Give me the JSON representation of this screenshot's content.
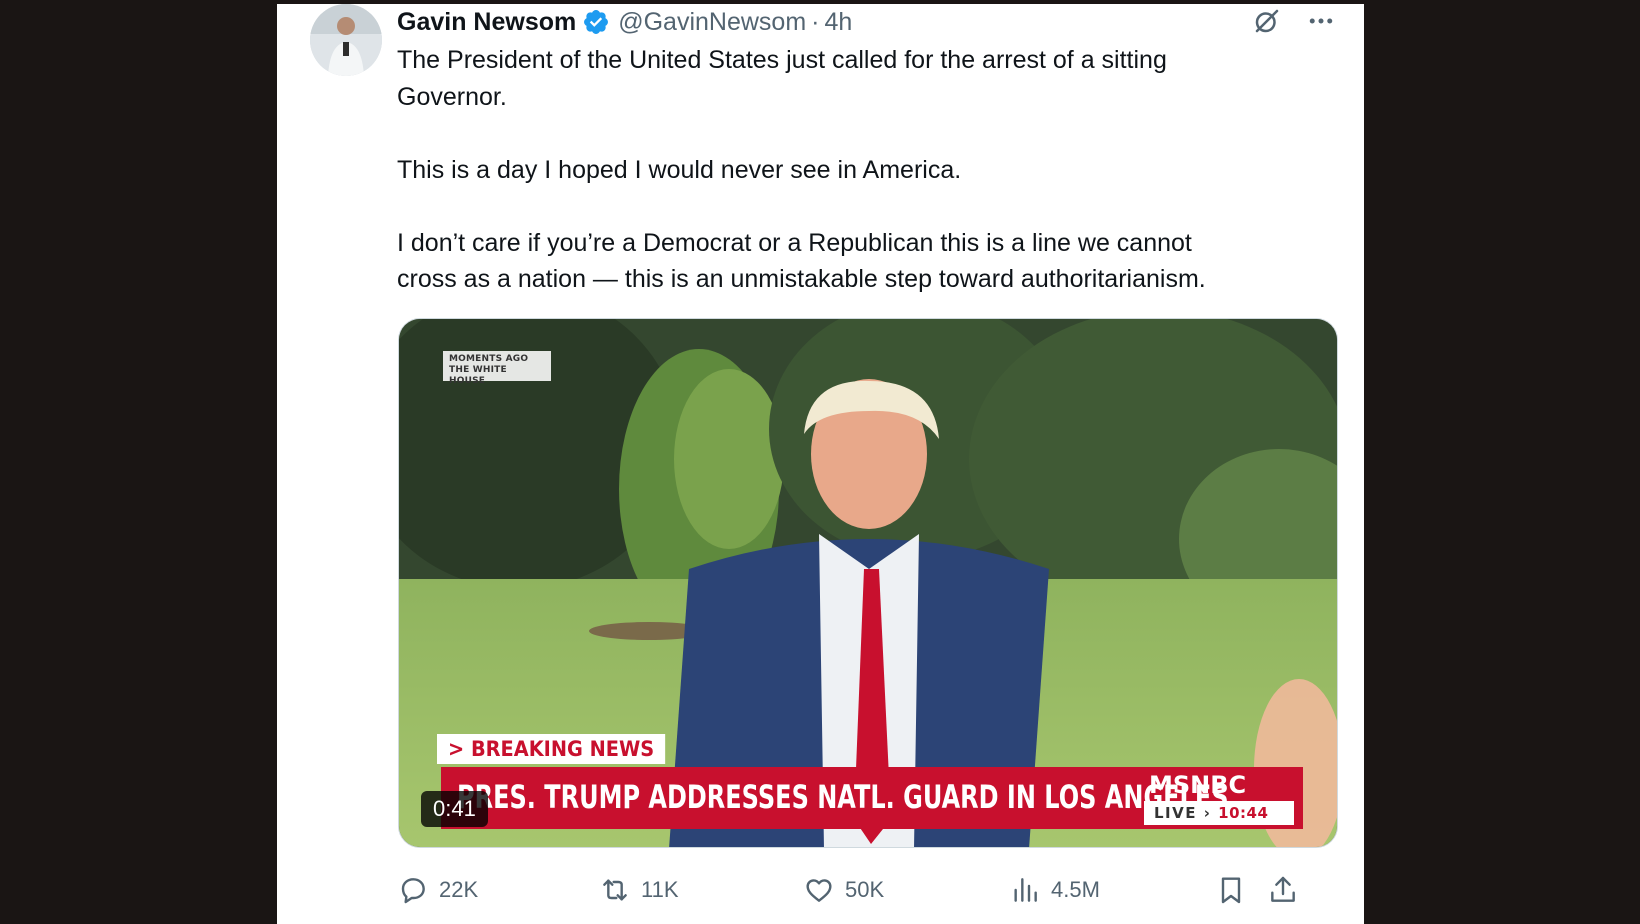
{
  "tweet": {
    "author_name": "Gavin Newsom",
    "handle": "@GavinNewsom",
    "separator": "·",
    "time": "4h",
    "paragraphs": [
      [
        "The President of the United States just called for the arrest of a sitting",
        "Governor."
      ],
      [
        "This is a day I hoped I would never see in America."
      ],
      [
        "I don’t care if you’re a Democrat or a Republican this is a line we cannot",
        "cross as a nation — this is an unmistakable step toward authoritarianism."
      ]
    ]
  },
  "icons": {
    "verified": "verified-badge-icon",
    "grok": "grok-icon",
    "more": "more-options-icon",
    "reply": "reply-icon",
    "retweet": "retweet-icon",
    "like": "like-icon",
    "views": "views-icon",
    "bookmark": "bookmark-icon",
    "share": "share-icon"
  },
  "video": {
    "overlay_tag": [
      "MOMENTS AGO",
      "THE WHITE HOUSE"
    ],
    "breaking_label": "> BREAKING NEWS",
    "headline": "PRES. TRUMP ADDRESSES NATL. GUARD IN LOS ANGELES",
    "network": "MSNBC",
    "live_label": "LIVE",
    "live_arrow": "›",
    "live_time": "10:44",
    "duration": "0:41"
  },
  "actions": {
    "replies": "22K",
    "retweets": "11K",
    "likes": "50K",
    "views": "4.5M"
  },
  "colors": {
    "verified_blue": "#1d9bf0",
    "text_primary": "#0f1419",
    "text_secondary": "#536471",
    "news_red": "#c8102e",
    "page_background": "#1a1514"
  }
}
